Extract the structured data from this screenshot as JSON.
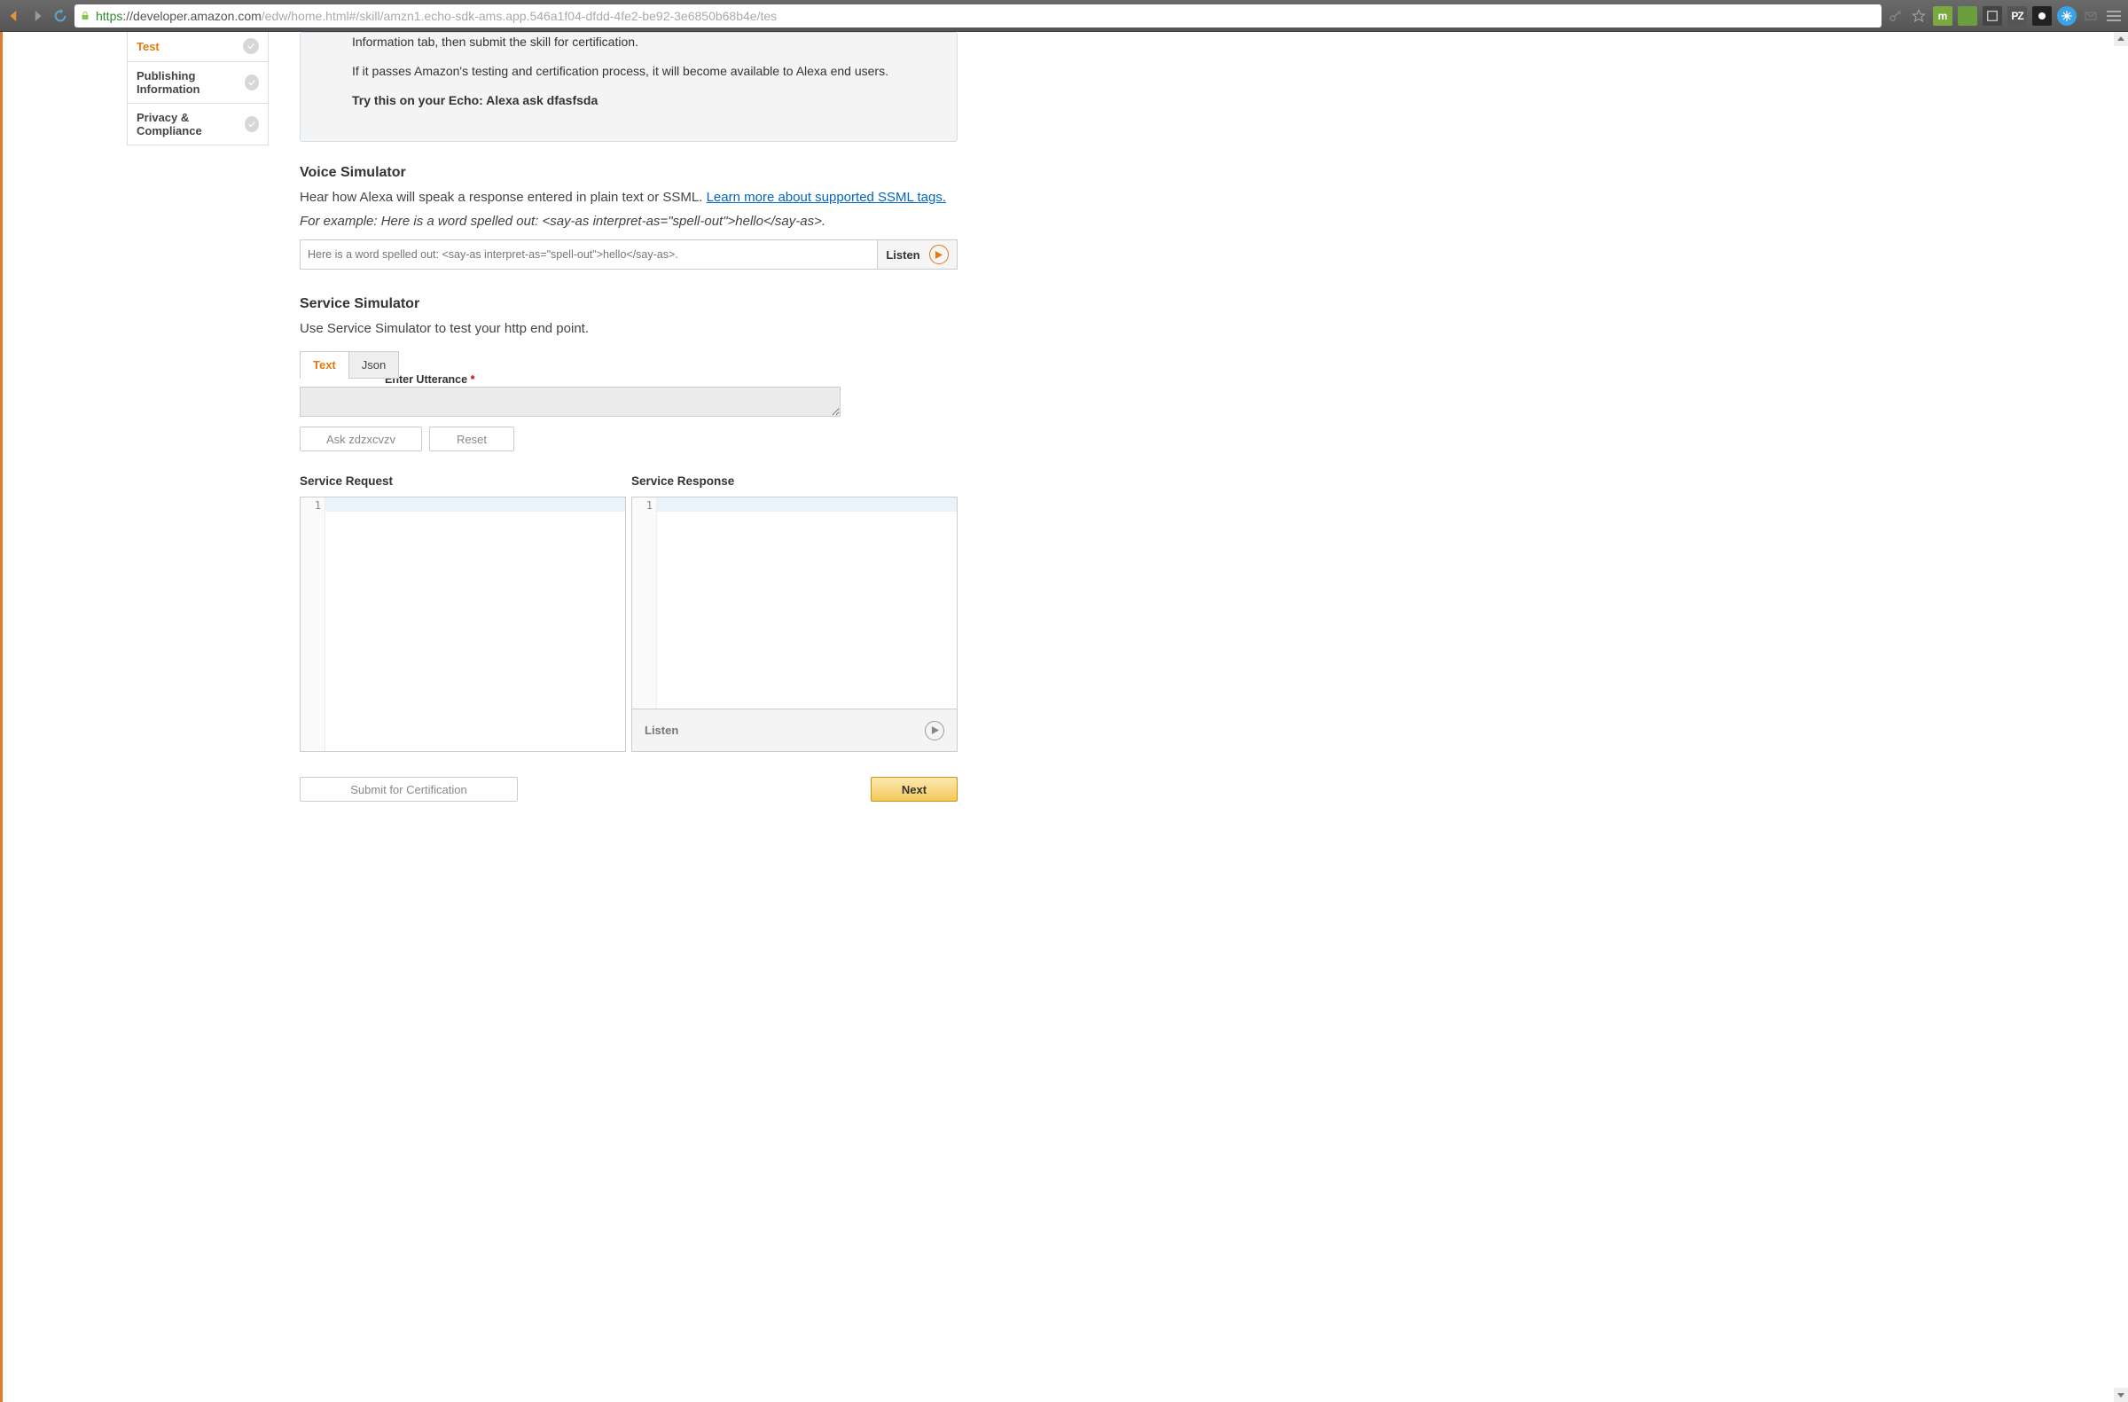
{
  "browser": {
    "url_scheme": "https",
    "url_host": "://developer.amazon.com",
    "url_path": "/edw/home.html#/skill/amzn1.echo-sdk-ams.app.546a1f04-dfdd-4fe2-be92-3e6850b68b4e/tes",
    "ext_m": "m",
    "ext_pz": "PZ"
  },
  "sidebar": {
    "items": [
      {
        "label": ""
      },
      {
        "label": "Test"
      },
      {
        "label": "Publishing Information"
      },
      {
        "label": "Privacy & Compliance"
      }
    ]
  },
  "info": {
    "line1": "Once you have completed testing on your device, please complete the Description and Publishing Information tab, then submit the skill for certification.",
    "line2": "If it passes Amazon's testing and certification process, it will become available to Alexa end users.",
    "try": "Try this on your Echo: Alexa ask dfasfsda"
  },
  "voice": {
    "title": "Voice Simulator",
    "desc_pre": "Hear how Alexa will speak a response entered in plain text or SSML. ",
    "link": "Learn more about supported SSML tags.",
    "example": "For example: Here is a word spelled out: <say-as interpret-as=\"spell-out\">hello</say-as>.",
    "placeholder": "Here is a word spelled out: <say-as interpret-as=\"spell-out\">hello</say-as>.",
    "listen": "Listen"
  },
  "service": {
    "title": "Service Simulator",
    "desc": "Use Service Simulator to test your http end point.",
    "tab_text": "Text",
    "tab_json": "Json",
    "utterance_label": "Enter Utterance",
    "ask_btn": "Ask zdzxcvzv",
    "reset_btn": "Reset",
    "request_title": "Service Request",
    "response_title": "Service Response",
    "line_no": "1",
    "resp_listen": "Listen"
  },
  "footer": {
    "submit": "Submit for Certification",
    "next": "Next"
  }
}
